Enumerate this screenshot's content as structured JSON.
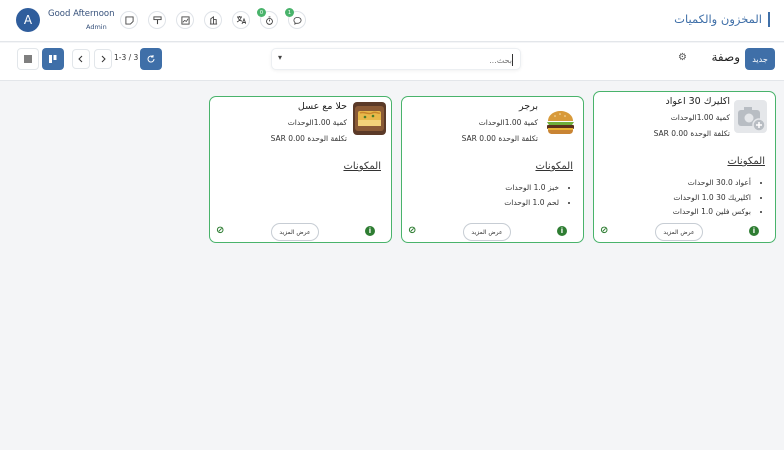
{
  "header": {
    "title": "المخزون والكميات",
    "avatar_letter": "A",
    "greeting": "Good Afternoon",
    "role": "Admin",
    "icons": [
      "sticky-note-icon",
      "paint-roller-icon",
      "chart-box-icon",
      "building-icon",
      "translate-icon",
      "stopwatch-icon",
      "chat-icon"
    ],
    "badges": {
      "stopwatch": "0",
      "chat": "1"
    }
  },
  "toolbar": {
    "new_label": "جديد",
    "page_name": "وصفة",
    "search_placeholder": "بحث...",
    "pager_text": "1-3 / 3"
  },
  "accent_color": "#3f6fa8",
  "border_color": "#49b36b",
  "cards": [
    {
      "name": "اكليرك 30 اعواد",
      "qty": "كمية 1.00الوحدات",
      "cost": "تكلفة الوحدة SAR 0.00",
      "ingredients_title": "المكونات",
      "ingredients": [
        "أعواد 30.0 الوحدات",
        "اكليريك 30 1.0 الوحدات",
        "بوكس فلين 1.0 الوحدات"
      ],
      "more_label": "عرض المزيد"
    },
    {
      "name": "برجر",
      "qty": "كمية 1.00الوحدات",
      "cost": "تكلفة الوحدة SAR 0.00",
      "ingredients_title": "المكونات",
      "ingredients": [
        "خبز 1.0 الوحدات",
        "لحم 1.0 الوحدات"
      ],
      "more_label": "عرض المزيد"
    },
    {
      "name": "حلا مع عسل",
      "qty": "كمية 1.00الوحدات",
      "cost": "تكلفة الوحدة SAR 0.00",
      "ingredients_title": "المكونات",
      "ingredients": [],
      "more_label": "عرض المزيد"
    }
  ]
}
